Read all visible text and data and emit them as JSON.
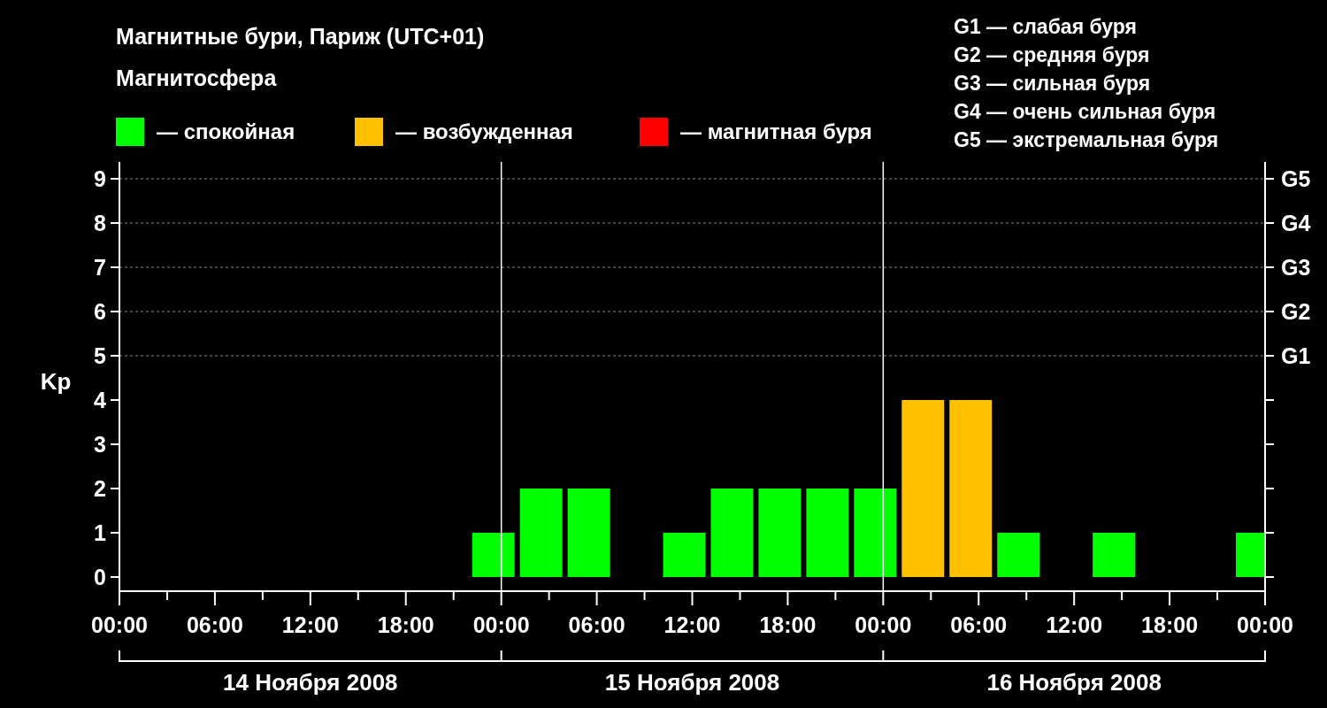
{
  "title": "Магнитные бури, Париж (UTC+01)",
  "legend": {
    "heading": "Магнитосфера"
  },
  "g_scale": [
    "G1 — слабая буря",
    "G2 — средняя буря",
    "G3 — сильная буря",
    "G4 — очень сильная буря",
    "G5 — экстремальная буря"
  ],
  "chart": {
    "chart_data": {
      "type": "bar",
      "ylabel": "Kp",
      "grid": true,
      "series": [
        {
          "name": "— спокойная",
          "color": "#00ff00",
          "values": [
            null,
            null,
            null,
            null,
            null,
            null,
            null,
            1,
            2,
            2,
            0,
            1,
            2,
            2,
            2,
            2,
            null,
            null,
            1,
            0,
            1,
            0,
            0,
            1
          ]
        },
        {
          "name": "— возбужденная",
          "color": "#ffc000",
          "values": [
            null,
            null,
            null,
            null,
            null,
            null,
            null,
            null,
            null,
            null,
            null,
            null,
            null,
            null,
            null,
            null,
            4,
            4,
            null,
            null,
            null,
            null,
            null,
            null
          ]
        },
        {
          "name": "— магнитная буря",
          "color": "#ff0000",
          "values": [
            null,
            null,
            null,
            null,
            null,
            null,
            null,
            null,
            null,
            null,
            null,
            null,
            null,
            null,
            null,
            null,
            null,
            null,
            null,
            null,
            null,
            null,
            null,
            null
          ]
        }
      ],
      "ylim": [
        -0.32,
        9.38
      ],
      "yticks": [
        0,
        1,
        2,
        3,
        4,
        5,
        6,
        7,
        8,
        9
      ]
    },
    "time_labels": [
      "00:00",
      "06:00",
      "12:00",
      "18:00",
      "00:00",
      "06:00",
      "12:00",
      "18:00",
      "00:00",
      "06:00",
      "12:00",
      "18:00",
      "00:00"
    ],
    "g_axis_labels": [
      "G5",
      "G4",
      "G3",
      "G2",
      "G1"
    ],
    "days": [
      "14 Ноября 2008",
      "15 Ноября 2008",
      "16 Ноября 2008"
    ]
  }
}
